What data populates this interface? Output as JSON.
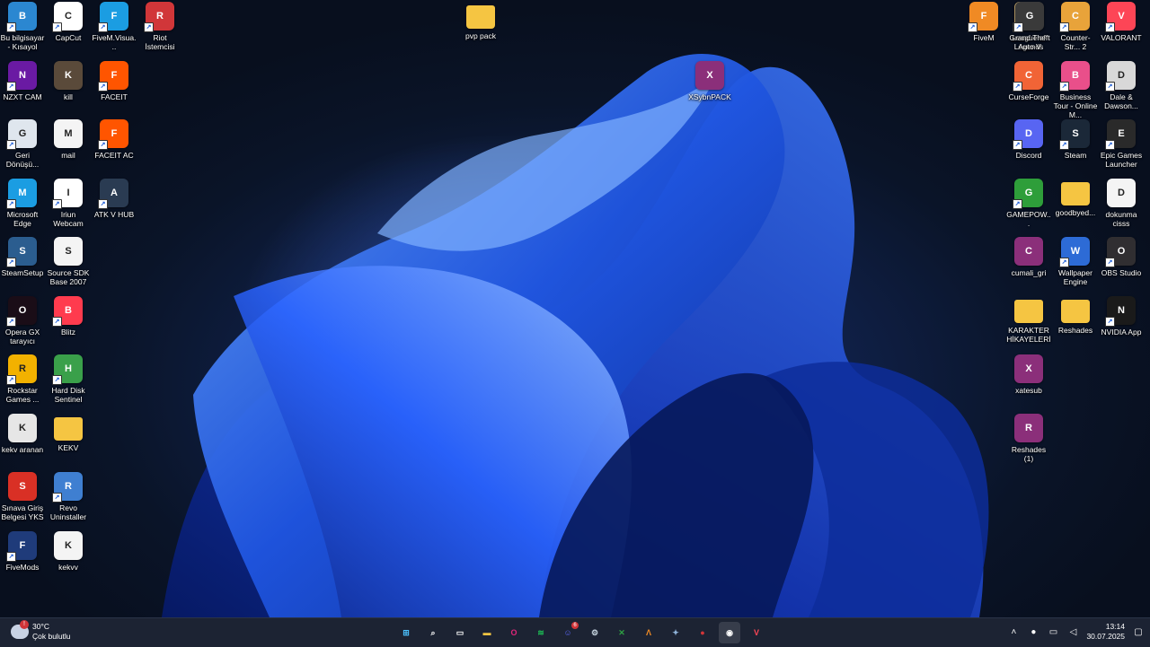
{
  "desktop": {
    "left_col1": [
      {
        "label": "Bu bilgisayar - Kısayol",
        "icon": "monitor-icon",
        "color": "#2b87d1"
      },
      {
        "label": "NZXT CAM",
        "icon": "nzxt-icon",
        "color": "#6a1aa3"
      },
      {
        "label": "Geri Dönüşü...",
        "icon": "recycle-bin-icon",
        "color": "#dfe6ee"
      },
      {
        "label": "Microsoft Edge",
        "icon": "edge-icon",
        "color": "#1b9de2"
      },
      {
        "label": "SteamSetup",
        "icon": "steam-setup-icon",
        "color": "#2b5d8f"
      },
      {
        "label": "Opera GX tarayıcı",
        "icon": "opera-gx-icon",
        "color": "#1a0d17"
      },
      {
        "label": "Rockstar Games ...",
        "icon": "rockstar-icon",
        "color": "#f2b100"
      },
      {
        "label": "kekv aranan",
        "icon": "image-file-icon",
        "color": "#e6e6e6"
      },
      {
        "label": "Sınava Giriş Belgesi YKS",
        "icon": "pdf-icon",
        "color": "#d93025"
      },
      {
        "label": "FiveMods",
        "icon": "fivemods-icon",
        "color": "#1f3b7a"
      }
    ],
    "left_col2": [
      {
        "label": "CapCut",
        "icon": "capcut-icon",
        "color": "#ffffff"
      },
      {
        "label": "kill",
        "icon": "video-file-icon",
        "color": "#5a4a3a"
      },
      {
        "label": "mail",
        "icon": "text-file-icon",
        "color": "#f4f4f4"
      },
      {
        "label": "Iriun Webcam",
        "icon": "webcam-icon",
        "color": "#ffffff"
      },
      {
        "label": "Source SDK Base 2007",
        "icon": "text-file-icon",
        "color": "#f4f4f4"
      },
      {
        "label": "Blitz",
        "icon": "blitz-icon",
        "color": "#ff3b4e"
      },
      {
        "label": "Hard Disk Sentinel",
        "icon": "hdd-icon",
        "color": "#3aa04a"
      },
      {
        "label": "KEKV",
        "icon": "folder-icon",
        "color": "#f5c542"
      },
      {
        "label": "Revo Uninstaller",
        "icon": "revo-icon",
        "color": "#3f7fd1"
      },
      {
        "label": "kekvv",
        "icon": "text-file-icon",
        "color": "#f4f4f4"
      }
    ],
    "left_col3": [
      {
        "label": "FiveM.Visua...",
        "icon": "edge-icon",
        "color": "#1b9de2"
      },
      {
        "label": "FACEIT",
        "icon": "faceit-icon",
        "color": "#ff5500"
      },
      {
        "label": "FACEIT AC",
        "icon": "faceit-ac-icon",
        "color": "#ff5500"
      },
      {
        "label": "ATK V HUB",
        "icon": "atk-icon",
        "color": "#2a3b52"
      }
    ],
    "left_col4": [
      {
        "label": "Riot İstemcisi",
        "icon": "riot-icon",
        "color": "#d13639"
      }
    ],
    "center": [
      {
        "label": "pvp pack",
        "icon": "folder-icon",
        "color": "#f5c542"
      },
      {
        "label": "XSybnPACK",
        "icon": "winrar-icon",
        "color": "#8b2f7a"
      }
    ],
    "right_col1": [
      {
        "label": "League of Legends",
        "icon": "league-icon",
        "color": "#c8aa6e"
      },
      {
        "label": "CurseForge",
        "icon": "curseforge-icon",
        "color": "#f16436"
      },
      {
        "label": "Discord",
        "icon": "discord-icon",
        "color": "#5865f2"
      },
      {
        "label": "GAMEPOW...",
        "icon": "gamepower-icon",
        "color": "#2e9e3a"
      },
      {
        "label": "cumali_gri",
        "icon": "winrar-icon",
        "color": "#8b2f7a"
      },
      {
        "label": "KARAKTER HİKAYELERİ",
        "icon": "folder-icon",
        "color": "#f5c542"
      },
      {
        "label": "xatesub",
        "icon": "winrar-icon",
        "color": "#8b2f7a"
      },
      {
        "label": "Reshades (1)",
        "icon": "winrar-icon",
        "color": "#8b2f7a"
      }
    ],
    "right_col0": [
      {
        "label": "FiveM",
        "icon": "fivem-icon",
        "color": "#f08a24"
      },
      {
        "label": "Grand Theft Auto V",
        "icon": "gta-icon",
        "color": "#3a3a3a"
      },
      {
        "label": "Counter-Str... 2",
        "icon": "cs2-icon",
        "color": "#e8a33a"
      },
      {
        "label": "VALORANT",
        "icon": "valorant-icon",
        "color": "#fd4556"
      }
    ],
    "right_col2": [
      {
        "label": "Business Tour - Online M...",
        "icon": "business-tour-icon",
        "color": "#e94f8a"
      },
      {
        "label": "Steam",
        "icon": "steam-icon",
        "color": "#1b2838"
      },
      {
        "label": "goodbyed...",
        "icon": "folder-icon",
        "color": "#f5c542"
      },
      {
        "label": "Wallpaper Engine",
        "icon": "wallpaper-engine-icon",
        "color": "#2d6bd6"
      },
      {
        "label": "Reshades",
        "icon": "folder-icon",
        "color": "#f5c542"
      }
    ],
    "right_col3": [
      {
        "label": "Dale & Dawson...",
        "icon": "printer-icon",
        "color": "#d8d8d8"
      },
      {
        "label": "Epic Games Launcher",
        "icon": "epic-games-icon",
        "color": "#2a2a2a"
      },
      {
        "label": "dokunma cisss",
        "icon": "text-file-icon",
        "color": "#f4f4f4"
      },
      {
        "label": "OBS Studio",
        "icon": "obs-icon",
        "color": "#302e31"
      },
      {
        "label": "NVIDIA App",
        "icon": "nvidia-icon",
        "color": "#1a1a1a"
      }
    ]
  },
  "taskbar": {
    "weather": {
      "temp": "30°C",
      "desc": "Çok bulutlu",
      "alert": "!"
    },
    "apps": [
      {
        "name": "start-button",
        "glyph": "⊞",
        "color": "#4cc2ff",
        "active": false
      },
      {
        "name": "search-button",
        "glyph": "⌕",
        "color": "#ffffff",
        "active": false
      },
      {
        "name": "task-view-button",
        "glyph": "▭",
        "color": "#ffffff",
        "active": false
      },
      {
        "name": "file-explorer-button",
        "glyph": "▬",
        "color": "#f5c542",
        "active": false
      },
      {
        "name": "opera-gx-button",
        "glyph": "O",
        "color": "#e0257a",
        "active": false
      },
      {
        "name": "spotify-button",
        "glyph": "≋",
        "color": "#1db954",
        "active": false
      },
      {
        "name": "discord-button",
        "glyph": "☺",
        "color": "#5865f2",
        "active": false,
        "badge": "6"
      },
      {
        "name": "steam-button",
        "glyph": "⚙",
        "color": "#c7d5e0",
        "active": false
      },
      {
        "name": "xbox-button",
        "glyph": "✕",
        "color": "#2ea043",
        "active": false
      },
      {
        "name": "fivem-button",
        "glyph": "Λ",
        "color": "#f08a24",
        "active": false
      },
      {
        "name": "app-button",
        "glyph": "✦",
        "color": "#8fb3d9",
        "active": false
      },
      {
        "name": "riot-button",
        "glyph": "●",
        "color": "#d13639",
        "active": false
      },
      {
        "name": "obs-button",
        "glyph": "◉",
        "color": "#ffffff",
        "active": true
      },
      {
        "name": "valorant-button",
        "glyph": "V",
        "color": "#fd4556",
        "active": false
      }
    ],
    "tray": {
      "time": "13:14",
      "date": "30.07.2025"
    }
  }
}
